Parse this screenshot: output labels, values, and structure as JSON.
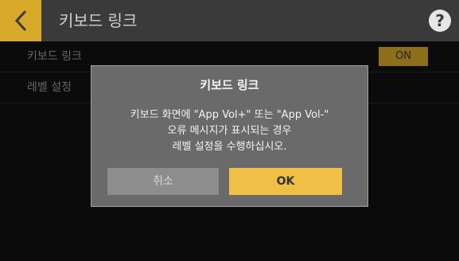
{
  "header": {
    "title": "키보드 링크",
    "back_icon": "chevron-left-icon",
    "help_glyph": "?"
  },
  "settings": {
    "rows": [
      {
        "label": "키보드 링크",
        "value": "ON"
      },
      {
        "label": "레벨 설정"
      }
    ]
  },
  "dialog": {
    "title": "키보드 링크",
    "lines": [
      "키보드 화면에 \"App Vol+\" 또는 \"App Vol-\"",
      "오류 메시지가 표시되는 경우",
      "레벨 설정을 수행하십시오."
    ],
    "cancel_label": "취소",
    "ok_label": "OK"
  },
  "colors": {
    "accent": "#d9a92a",
    "ok_button": "#f0bf46",
    "dialog_bg": "#6a6a6a"
  }
}
